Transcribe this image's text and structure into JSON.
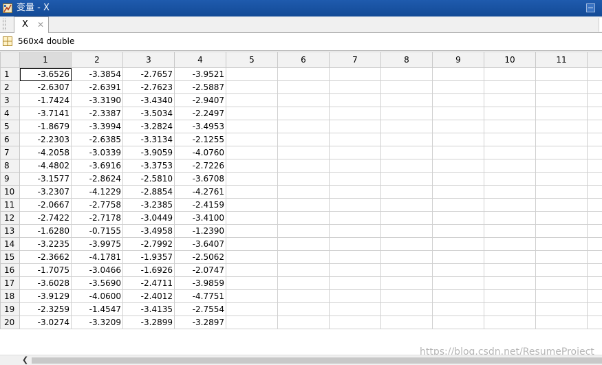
{
  "window": {
    "title": "变量 - X"
  },
  "tabs": [
    {
      "label": "X"
    }
  ],
  "info": {
    "text": "560x4 double"
  },
  "columns": [
    "1",
    "2",
    "3",
    "4",
    "5",
    "6",
    "7",
    "8",
    "9",
    "10",
    "11"
  ],
  "rows": [
    {
      "idx": "1",
      "vals": [
        "-3.6526",
        "-3.3854",
        "-2.7657",
        "-3.9521"
      ]
    },
    {
      "idx": "2",
      "vals": [
        "-2.6307",
        "-2.6391",
        "-2.7623",
        "-2.5887"
      ]
    },
    {
      "idx": "3",
      "vals": [
        "-1.7424",
        "-3.3190",
        "-3.4340",
        "-2.9407"
      ]
    },
    {
      "idx": "4",
      "vals": [
        "-3.7141",
        "-2.3387",
        "-3.5034",
        "-2.2497"
      ]
    },
    {
      "idx": "5",
      "vals": [
        "-1.8679",
        "-3.3994",
        "-3.2824",
        "-3.4953"
      ]
    },
    {
      "idx": "6",
      "vals": [
        "-2.2303",
        "-2.6385",
        "-3.3134",
        "-2.1255"
      ]
    },
    {
      "idx": "7",
      "vals": [
        "-4.2058",
        "-3.0339",
        "-3.9059",
        "-4.0760"
      ]
    },
    {
      "idx": "8",
      "vals": [
        "-4.4802",
        "-3.6916",
        "-3.3753",
        "-2.7226"
      ]
    },
    {
      "idx": "9",
      "vals": [
        "-3.1577",
        "-2.8624",
        "-2.5810",
        "-3.6708"
      ]
    },
    {
      "idx": "10",
      "vals": [
        "-3.2307",
        "-4.1229",
        "-2.8854",
        "-4.2761"
      ]
    },
    {
      "idx": "11",
      "vals": [
        "-2.0667",
        "-2.7758",
        "-3.2385",
        "-2.4159"
      ]
    },
    {
      "idx": "12",
      "vals": [
        "-2.7422",
        "-2.7178",
        "-3.0449",
        "-3.4100"
      ]
    },
    {
      "idx": "13",
      "vals": [
        "-1.6280",
        "-0.7155",
        "-3.4958",
        "-1.2390"
      ]
    },
    {
      "idx": "14",
      "vals": [
        "-3.2235",
        "-3.9975",
        "-2.7992",
        "-3.6407"
      ]
    },
    {
      "idx": "15",
      "vals": [
        "-2.3662",
        "-4.1781",
        "-1.9357",
        "-2.5062"
      ]
    },
    {
      "idx": "16",
      "vals": [
        "-1.7075",
        "-3.0466",
        "-1.6926",
        "-2.0747"
      ]
    },
    {
      "idx": "17",
      "vals": [
        "-3.6028",
        "-3.5690",
        "-2.4711",
        "-3.9859"
      ]
    },
    {
      "idx": "18",
      "vals": [
        "-3.9129",
        "-4.0600",
        "-2.4012",
        "-4.7751"
      ]
    },
    {
      "idx": "19",
      "vals": [
        "-2.3259",
        "-1.4547",
        "-3.4135",
        "-2.7554"
      ]
    },
    {
      "idx": "20",
      "vals": [
        "-3.0274",
        "-3.3209",
        "-3.2899",
        "-3.2897"
      ]
    }
  ],
  "watermark": "https://blog.csdn.net/ResumeProject"
}
